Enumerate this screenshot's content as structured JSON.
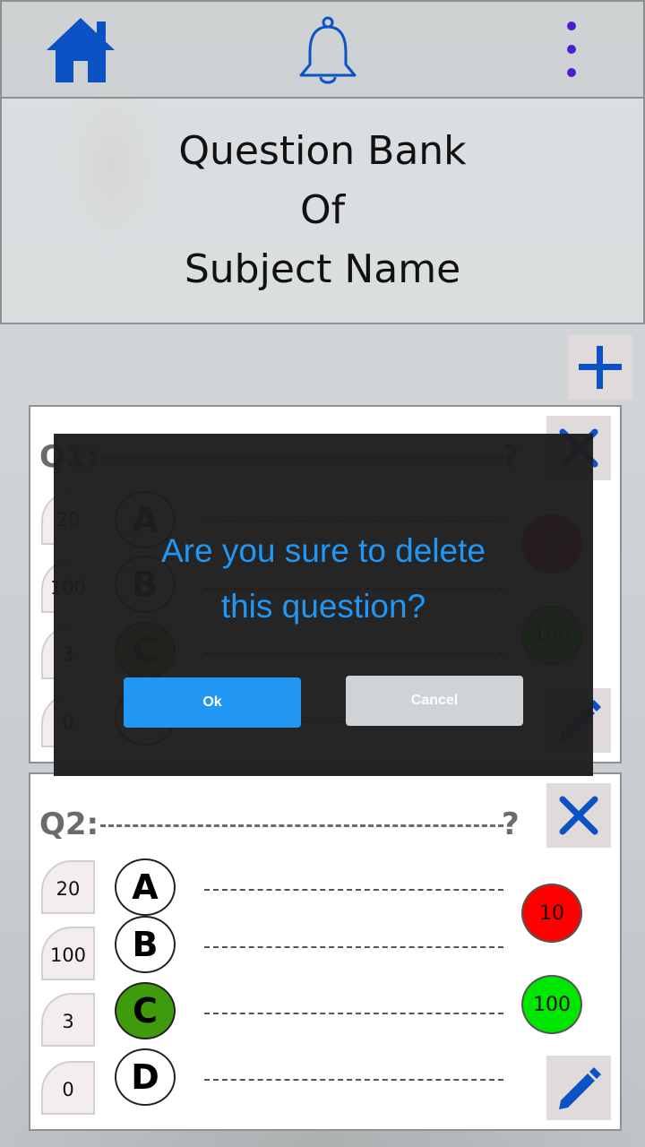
{
  "header": {
    "icons": [
      "home-icon",
      "bell-icon",
      "more-vert-icon"
    ],
    "accent": "#0b52c4"
  },
  "title": {
    "line1": "Question Bank",
    "line2": "Of",
    "line3": "Subject Name"
  },
  "questions": [
    {
      "label": "Q1:",
      "mark": "?",
      "options": [
        {
          "letter": "A",
          "score": "20",
          "correct": false
        },
        {
          "letter": "B",
          "score": "100",
          "correct": false
        },
        {
          "letter": "C",
          "score": "3",
          "correct": true
        },
        {
          "letter": "D",
          "score": "0",
          "correct": false
        }
      ],
      "stats": [
        {
          "value": "10",
          "color": "#ff0000"
        },
        {
          "value": "100",
          "color": "#00e600"
        }
      ]
    },
    {
      "label": "Q2:",
      "mark": "?",
      "options": [
        {
          "letter": "A",
          "score": "20",
          "correct": false
        },
        {
          "letter": "B",
          "score": "100",
          "correct": false
        },
        {
          "letter": "C",
          "score": "3",
          "correct": true
        },
        {
          "letter": "D",
          "score": "0",
          "correct": false
        }
      ],
      "stats": [
        {
          "value": "10",
          "color": "#ff0000"
        },
        {
          "value": "100",
          "color": "#00e600"
        }
      ]
    }
  ],
  "dialog": {
    "message_line1": "Are you sure to delete",
    "message_line2": "this question?",
    "ok_label": "Ok",
    "cancel_label": "Cancel",
    "ok_color": "#2196f3",
    "cancel_color": "#cfd3d6"
  }
}
